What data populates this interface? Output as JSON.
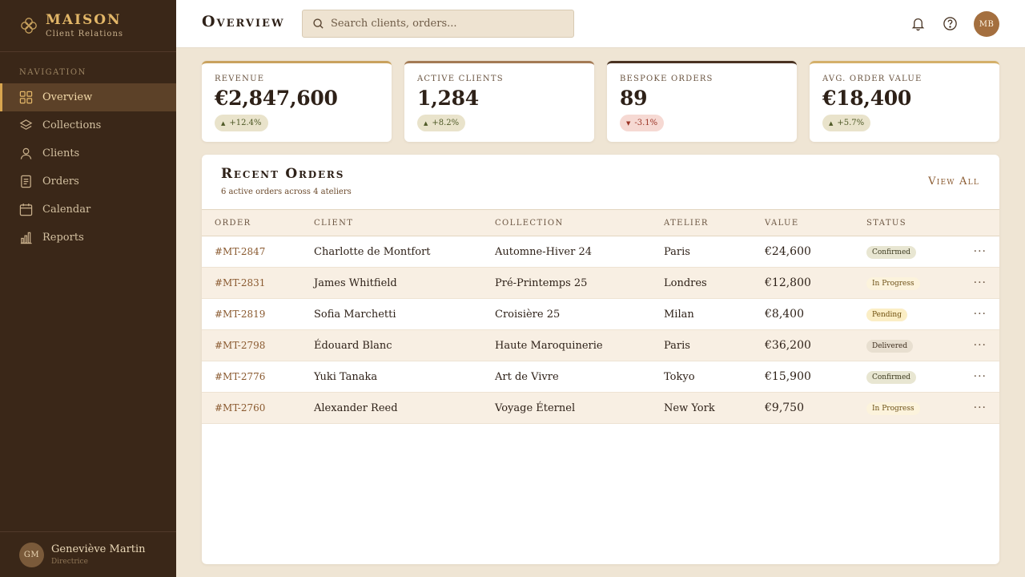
{
  "brand": {
    "name": "MAISON",
    "subtitle": "Client Relations"
  },
  "sidebar": {
    "section_label": "Navigation",
    "items": [
      {
        "label": "Overview",
        "icon": "grid-icon",
        "active": true
      },
      {
        "label": "Collections",
        "icon": "layers-icon"
      },
      {
        "label": "Clients",
        "icon": "user-icon"
      },
      {
        "label": "Orders",
        "icon": "document-icon"
      },
      {
        "label": "Calendar",
        "icon": "calendar-icon"
      },
      {
        "label": "Reports",
        "icon": "bar-chart-icon"
      }
    ],
    "user": {
      "initials": "GM",
      "name": "Geneviève Martin",
      "role": "Directrice"
    }
  },
  "header": {
    "title": "Overview",
    "search_placeholder": "Search clients, orders...",
    "avatar_initials": "MB"
  },
  "kpis": [
    {
      "label": "Revenue",
      "value": "€2,847,600",
      "delta": "+12.4%",
      "trend": "up",
      "accent": "#c9a25e"
    },
    {
      "label": "Active Clients",
      "value": "1,284",
      "delta": "+8.2%",
      "trend": "up",
      "accent": "#a47b55"
    },
    {
      "label": "Bespoke Orders",
      "value": "89",
      "delta": "-3.1%",
      "trend": "down",
      "accent": "#4a3322"
    },
    {
      "label": "Avg. Order Value",
      "value": "€18,400",
      "delta": "+5.7%",
      "trend": "up",
      "accent": "#d4b06a"
    }
  ],
  "orders": {
    "title": "Recent Orders",
    "subtitle": "6 active orders across 4 ateliers",
    "view_all": "View All",
    "columns": [
      "Order",
      "Client",
      "Collection",
      "Atelier",
      "Value",
      "Status"
    ],
    "rows": [
      {
        "id": "#MT-2847",
        "client": "Charlotte de Montfort",
        "collection": "Automne-Hiver 24",
        "atelier": "Paris",
        "value": "€24,600",
        "status": "Confirmed"
      },
      {
        "id": "#MT-2831",
        "client": "James Whitfield",
        "collection": "Pré-Printemps 25",
        "atelier": "Londres",
        "value": "€12,800",
        "status": "In Progress"
      },
      {
        "id": "#MT-2819",
        "client": "Sofia Marchetti",
        "collection": "Croisière 25",
        "atelier": "Milan",
        "value": "€8,400",
        "status": "Pending"
      },
      {
        "id": "#MT-2798",
        "client": "Édouard Blanc",
        "collection": "Haute Maroquinerie",
        "atelier": "Paris",
        "value": "€36,200",
        "status": "Delivered"
      },
      {
        "id": "#MT-2776",
        "client": "Yuki Tanaka",
        "collection": "Art de Vivre",
        "atelier": "Tokyo",
        "value": "€15,900",
        "status": "Confirmed"
      },
      {
        "id": "#MT-2760",
        "client": "Alexander Reed",
        "collection": "Voyage Éternel",
        "atelier": "New York",
        "value": "€9,750",
        "status": "In Progress"
      }
    ],
    "more_glyph": "···"
  }
}
